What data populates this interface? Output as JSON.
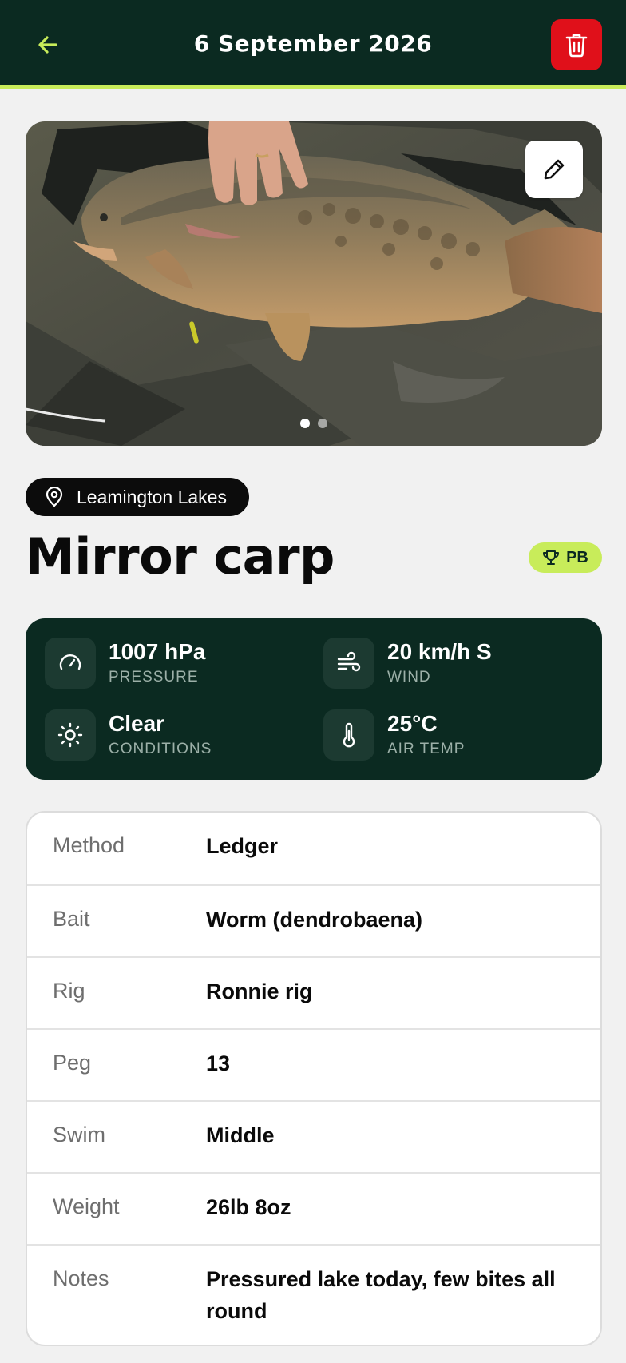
{
  "header": {
    "title": "6 September 2026"
  },
  "photo": {
    "page_count": 2,
    "active_index": 0,
    "description": "Mirror carp on an unhooking mat"
  },
  "location": {
    "name": "Leamington Lakes"
  },
  "catch": {
    "species": "Mirror carp",
    "badge": "PB"
  },
  "weather": {
    "items": [
      {
        "value": "1007 hPa",
        "label": "PRESSURE",
        "icon": "gauge-icon"
      },
      {
        "value": "20 km/h S",
        "label": "WIND",
        "icon": "wind-icon"
      },
      {
        "value": "Clear",
        "label": "CONDITIONS",
        "icon": "sun-icon"
      },
      {
        "value": "25°C",
        "label": "AIR TEMP",
        "icon": "thermometer-icon"
      }
    ]
  },
  "details": [
    {
      "label": "Method",
      "value": "Ledger"
    },
    {
      "label": "Bait",
      "value": "Worm (dendrobaena)"
    },
    {
      "label": "Rig",
      "value": "Ronnie rig"
    },
    {
      "label": "Peg",
      "value": "13"
    },
    {
      "label": "Swim",
      "value": "Middle"
    },
    {
      "label": "Weight",
      "value": "26lb 8oz"
    },
    {
      "label": "Notes",
      "value": "Pressured lake today, few bites all round"
    }
  ],
  "colors": {
    "header_bg": "#0b2a21",
    "accent": "#c8ec5a",
    "danger": "#e0101a"
  }
}
